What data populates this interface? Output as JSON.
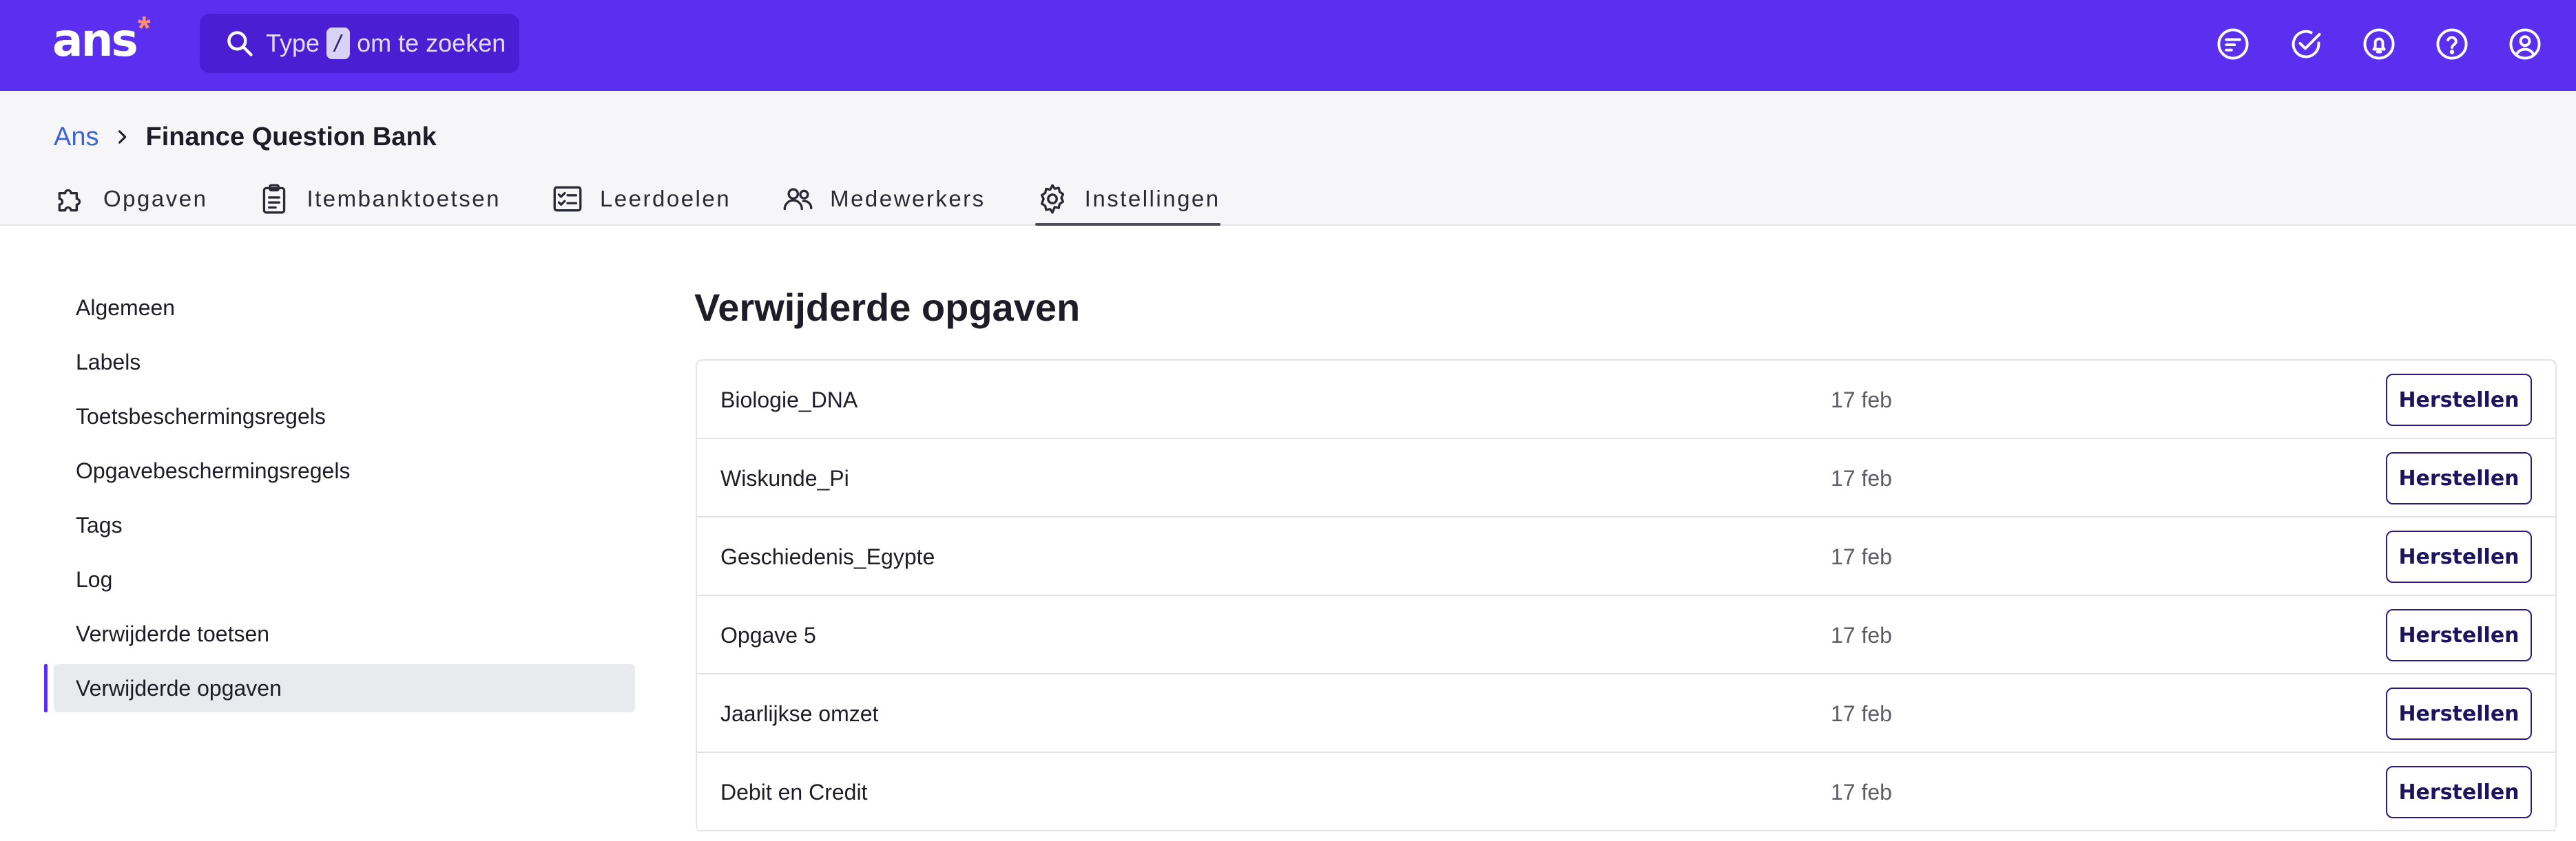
{
  "header": {
    "logo_text": "ans",
    "logo_star": "*",
    "search": {
      "prefix": "Type",
      "key": "/",
      "suffix": "om te zoeken"
    },
    "icons": [
      "tasks-icon",
      "check-circle-icon",
      "bell-icon",
      "help-icon",
      "user-icon"
    ]
  },
  "breadcrumb": {
    "root": "Ans",
    "current": "Finance Question Bank"
  },
  "tabs": [
    {
      "label": "Opgaven",
      "icon": "puzzle-icon"
    },
    {
      "label": "Itembanktoetsen",
      "icon": "clipboard-icon"
    },
    {
      "label": "Leerdoelen",
      "icon": "checklist-icon"
    },
    {
      "label": "Medewerkers",
      "icon": "users-icon"
    },
    {
      "label": "Instellingen",
      "icon": "gear-icon",
      "active": true
    }
  ],
  "sidebar": {
    "items": [
      {
        "label": "Algemeen"
      },
      {
        "label": "Labels"
      },
      {
        "label": "Toetsbeschermingsregels"
      },
      {
        "label": "Opgavebeschermingsregels"
      },
      {
        "label": "Tags"
      },
      {
        "label": "Log"
      },
      {
        "label": "Verwijderde toetsen"
      },
      {
        "label": "Verwijderde opgaven",
        "active": true
      }
    ]
  },
  "main": {
    "title": "Verwijderde opgaven",
    "restore_label": "Herstellen",
    "rows": [
      {
        "name": "Biologie_DNA",
        "date": "17 feb"
      },
      {
        "name": "Wiskunde_Pi",
        "date": "17 feb"
      },
      {
        "name": "Geschiedenis_Egypte",
        "date": "17 feb"
      },
      {
        "name": "Opgave 5",
        "date": "17 feb"
      },
      {
        "name": "Jaarlijkse omzet",
        "date": "17 feb"
      },
      {
        "name": "Debit en Credit",
        "date": "17 feb"
      }
    ]
  },
  "colors": {
    "brand": "#5b2ff0",
    "search_bg": "#4a1ed3",
    "star": "#ff8f72",
    "link": "#3d63d6",
    "button_border": "#2a1a86"
  }
}
